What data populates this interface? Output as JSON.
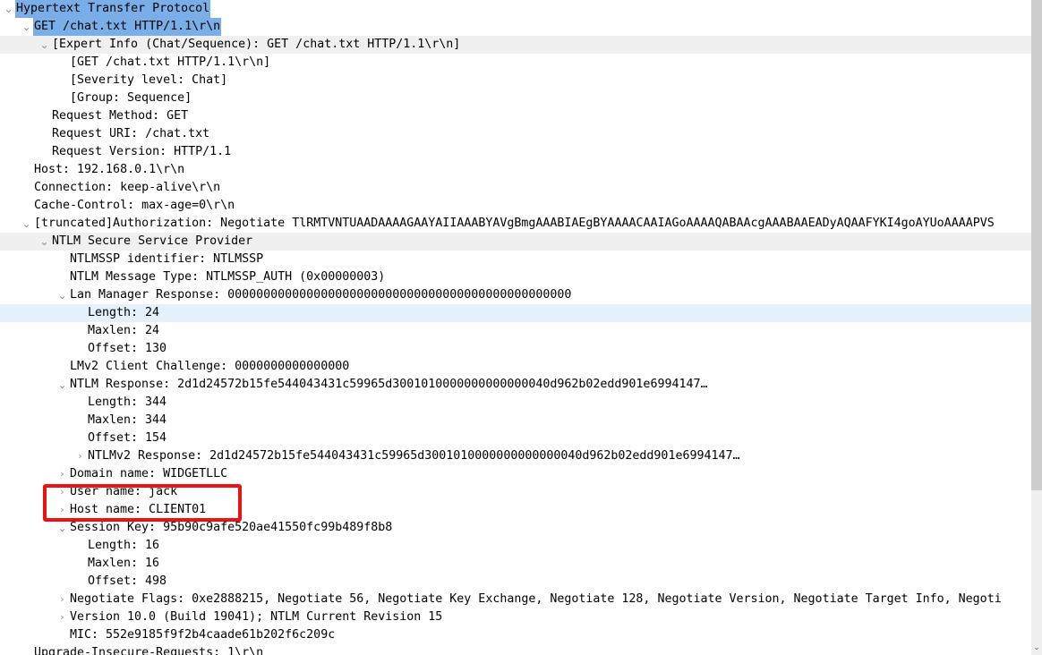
{
  "pane": {
    "name": "packet-details-tree",
    "selection_color": "#7aaee8",
    "alt_row_color": "#f0f0f0",
    "highlight_row_color": "#e4f0fb",
    "annotation_color": "#ee1111"
  },
  "icons": {
    "expanded": "⌄",
    "collapsed": "›",
    "scroll_down": "⌄"
  },
  "rows": [
    {
      "indent": 0,
      "twisty": "expanded",
      "state": "selected",
      "text": "Hypertext Transfer Protocol"
    },
    {
      "indent": 1,
      "twisty": "expanded",
      "state": "selected",
      "text": "GET /chat.txt HTTP/1.1\\r\\n"
    },
    {
      "indent": 2,
      "twisty": "expanded",
      "state": "alt",
      "text": "[Expert Info (Chat/Sequence): GET /chat.txt HTTP/1.1\\r\\n]"
    },
    {
      "indent": 3,
      "twisty": "none",
      "state": "normal",
      "text": "[GET /chat.txt HTTP/1.1\\r\\n]"
    },
    {
      "indent": 3,
      "twisty": "none",
      "state": "normal",
      "text": "[Severity level: Chat]"
    },
    {
      "indent": 3,
      "twisty": "none",
      "state": "normal",
      "text": "[Group: Sequence]"
    },
    {
      "indent": 2,
      "twisty": "none",
      "state": "normal",
      "text": "Request Method: GET"
    },
    {
      "indent": 2,
      "twisty": "none",
      "state": "normal",
      "text": "Request URI: /chat.txt"
    },
    {
      "indent": 2,
      "twisty": "none",
      "state": "normal",
      "text": "Request Version: HTTP/1.1"
    },
    {
      "indent": 1,
      "twisty": "none",
      "state": "normal",
      "text": "Host: 192.168.0.1\\r\\n"
    },
    {
      "indent": 1,
      "twisty": "none",
      "state": "normal",
      "text": "Connection: keep-alive\\r\\n"
    },
    {
      "indent": 1,
      "twisty": "none",
      "state": "normal",
      "text": "Cache-Control: max-age=0\\r\\n"
    },
    {
      "indent": 1,
      "twisty": "expanded",
      "state": "normal",
      "text": "[truncated]Authorization: Negotiate TlRMTVNTUAADAAAAGAAYAIIAAABYAVgBmgAAABIAEgBYAAAACAAIAGoAAAAQABAAcgAAABAAEADyAQAAFYKI4goAYUoAAAAPVS"
    },
    {
      "indent": 2,
      "twisty": "expanded",
      "state": "alt",
      "text": "NTLM Secure Service Provider"
    },
    {
      "indent": 3,
      "twisty": "none",
      "state": "normal",
      "text": "NTLMSSP identifier: NTLMSSP"
    },
    {
      "indent": 3,
      "twisty": "none",
      "state": "normal",
      "text": "NTLM Message Type: NTLMSSP_AUTH (0x00000003)"
    },
    {
      "indent": 3,
      "twisty": "expanded",
      "state": "normal",
      "text": "Lan Manager Response: 000000000000000000000000000000000000000000000000"
    },
    {
      "indent": 4,
      "twisty": "none",
      "state": "lightblue",
      "text": "Length: 24"
    },
    {
      "indent": 4,
      "twisty": "none",
      "state": "normal",
      "text": "Maxlen: 24"
    },
    {
      "indent": 4,
      "twisty": "none",
      "state": "normal",
      "text": "Offset: 130"
    },
    {
      "indent": 3,
      "twisty": "none",
      "state": "normal",
      "text": "LMv2 Client Challenge: 0000000000000000"
    },
    {
      "indent": 3,
      "twisty": "expanded",
      "state": "normal",
      "text": "NTLM Response: 2d1d24572b15fe544043431c59965d3001010000000000000040d962b02edd901e6994147…"
    },
    {
      "indent": 4,
      "twisty": "none",
      "state": "normal",
      "text": "Length: 344"
    },
    {
      "indent": 4,
      "twisty": "none",
      "state": "normal",
      "text": "Maxlen: 344"
    },
    {
      "indent": 4,
      "twisty": "none",
      "state": "normal",
      "text": "Offset: 154"
    },
    {
      "indent": 4,
      "twisty": "collapsed",
      "state": "normal",
      "text": "NTLMv2 Response: 2d1d24572b15fe544043431c59965d3001010000000000000040d962b02edd901e6994147…"
    },
    {
      "indent": 3,
      "twisty": "collapsed",
      "state": "normal",
      "text": "Domain name: WIDGETLLC"
    },
    {
      "indent": 3,
      "twisty": "collapsed",
      "state": "normal",
      "text": "User name: jack"
    },
    {
      "indent": 3,
      "twisty": "collapsed",
      "state": "normal",
      "text": "Host name: CLIENT01"
    },
    {
      "indent": 3,
      "twisty": "expanded",
      "state": "normal",
      "text": "Session Key: 95b90c9afe520ae41550fc99b489f8b8"
    },
    {
      "indent": 4,
      "twisty": "none",
      "state": "normal",
      "text": "Length: 16"
    },
    {
      "indent": 4,
      "twisty": "none",
      "state": "normal",
      "text": "Maxlen: 16"
    },
    {
      "indent": 4,
      "twisty": "none",
      "state": "normal",
      "text": "Offset: 498"
    },
    {
      "indent": 3,
      "twisty": "collapsed",
      "state": "normal",
      "text": "Negotiate Flags: 0xe2888215, Negotiate 56, Negotiate Key Exchange, Negotiate 128, Negotiate Version, Negotiate Target Info, Negoti"
    },
    {
      "indent": 3,
      "twisty": "collapsed",
      "state": "normal",
      "text": "Version 10.0 (Build 19041); NTLM Current Revision 15"
    },
    {
      "indent": 3,
      "twisty": "none",
      "state": "normal",
      "text": "MIC: 552e9185f9f2b4caade61b202f6c209c"
    },
    {
      "indent": 1,
      "twisty": "none",
      "state": "normal",
      "text": "Upgrade-Insecure-Requests: 1\\r\\n"
    }
  ]
}
